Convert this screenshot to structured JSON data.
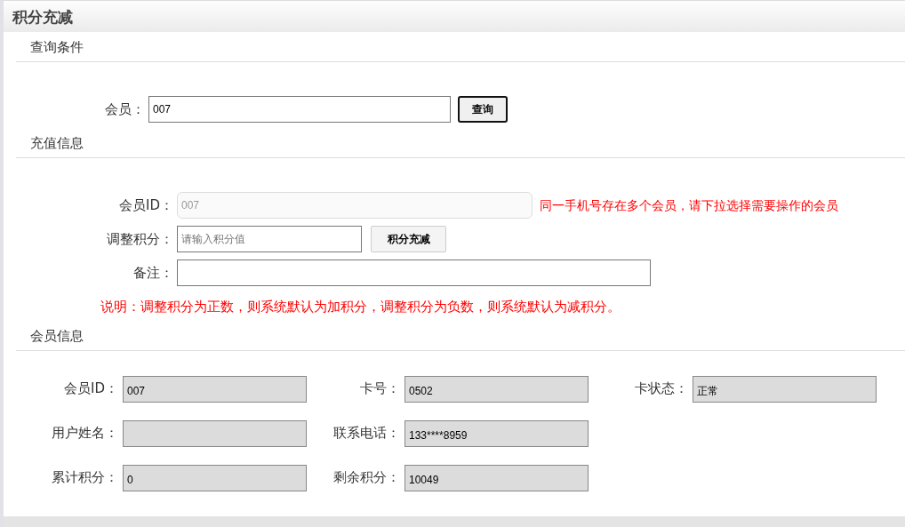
{
  "title": "积分充减",
  "query": {
    "heading": "查询条件",
    "member_label": "会员：",
    "member_value": "007",
    "button": "查询"
  },
  "recharge": {
    "heading": "充值信息",
    "member_id_label": "会员ID：",
    "member_id_value": "007",
    "member_id_disabled": true,
    "hint": "同一手机号存在多个会员，请下拉选择需要操作的会员",
    "adjust_label": "调整积分：",
    "adjust_placeholder": "请输入积分值",
    "adjust_button": "积分充减",
    "remark_label": "备注：",
    "note": "说明：调整积分为正数，则系统默认为加积分，调整积分为负数，则系统默认为减积分。"
  },
  "member_info": {
    "heading": "会员信息",
    "rows": [
      [
        {
          "label": "会员ID：",
          "value": "007"
        },
        {
          "label": "卡号：",
          "value": "0502"
        },
        {
          "label": "卡状态：",
          "value": "正常"
        }
      ],
      [
        {
          "label": "用户姓名："
        },
        {
          "label": "联系电话：",
          "value": "133****8959"
        }
      ],
      [
        {
          "label": "累计积分：",
          "value": "0"
        },
        {
          "label": "剩余积分：",
          "value": "10049"
        }
      ]
    ]
  }
}
